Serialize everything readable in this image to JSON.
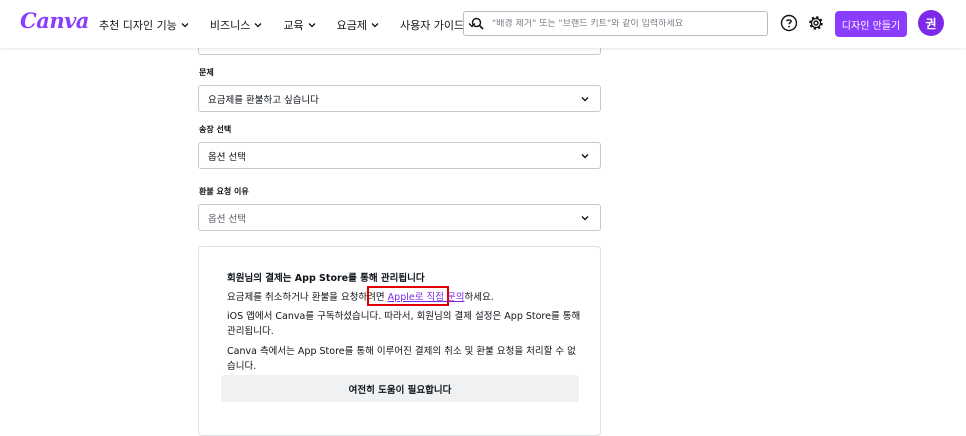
{
  "header": {
    "logo": "Canva",
    "nav": [
      "추천 디자인 기능",
      "비즈니스",
      "교육",
      "요금제",
      "사용자 가이드"
    ],
    "search_placeholder": "\"배경 제거\" 또는 \"브랜드 키트\"와 같이 입력하세요",
    "create_button": "디자인 만들기",
    "avatar_initial": "권",
    "accent_color": "#8b3dff"
  },
  "form": {
    "issue_label": "문제",
    "issue_value": "요금제를 환불하고 싶습니다",
    "seat_label": "송장 선택",
    "seat_value": "옵션 선택",
    "reason_label": "환불 요청 이유",
    "reason_value": "옵션 선택"
  },
  "info": {
    "title": "회원님의 결제는 App Store를 통해 관리됩니다",
    "line1_before": "요금제를 취소하거나 환불을 요청하려면 ",
    "line1_link": "Apple로 직접 문의",
    "line1_after": "하세요.",
    "line2": "iOS 앱에서 Canva를 구독하셨습니다. 따라서, 회원님의 결제 설정은 App Store를 통해 관리됩니다.",
    "line3": "Canva 측에서는 App Store를 통해 이루어진 결제의 취소 및 환불 요청을 처리할 수 없습니다.",
    "help_button": "여전히 도움이 필요합니다"
  }
}
